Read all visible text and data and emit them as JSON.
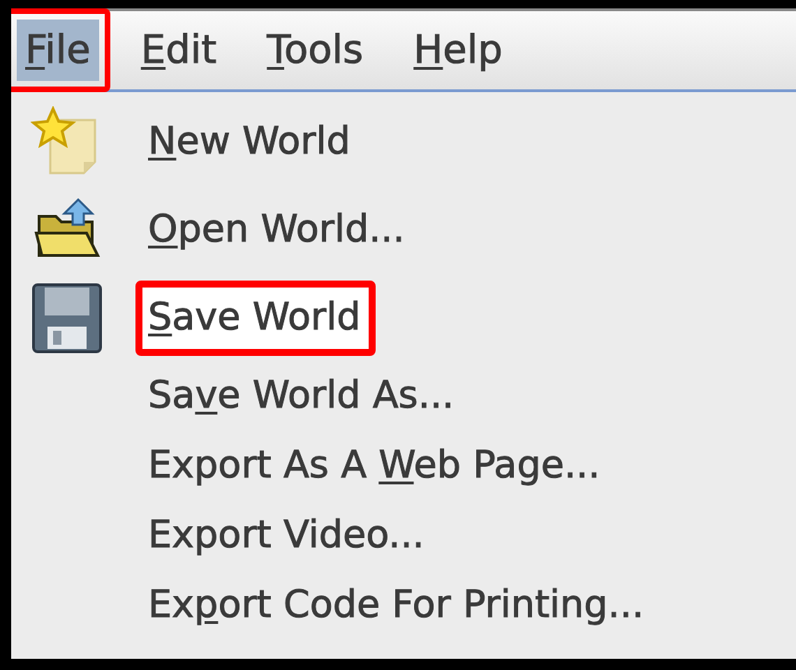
{
  "menubar": [
    {
      "mnemonic": "F",
      "after": "ile",
      "selected": true,
      "highlighted": true
    },
    {
      "mnemonic": "E",
      "after": "dit",
      "selected": false,
      "highlighted": false
    },
    {
      "mnemonic": "T",
      "after": "ools",
      "selected": false,
      "highlighted": false
    },
    {
      "mnemonic": "H",
      "after": "elp",
      "selected": false,
      "highlighted": false
    }
  ],
  "menu_items": [
    {
      "kind": "new",
      "mnemonic": "N",
      "after": "ew World",
      "highlighted": false
    },
    {
      "kind": "open",
      "mnemonic": "O",
      "after": "pen World...",
      "highlighted": false
    },
    {
      "kind": "save",
      "mnemonic": "S",
      "after": "ave World",
      "highlighted": true
    },
    {
      "kind": "plain",
      "before": "Sa",
      "mnemonic": "v",
      "after": "e World As...",
      "highlighted": false
    },
    {
      "kind": "plain",
      "before": "Export As A ",
      "mnemonic": "W",
      "after": "eb Page...",
      "highlighted": false
    },
    {
      "kind": "plain",
      "before": "Export Video...",
      "highlighted": false
    },
    {
      "kind": "plain",
      "before": "Ex",
      "mnemonic": "p",
      "after": "ort Code For Printing...",
      "highlighted": false
    }
  ]
}
